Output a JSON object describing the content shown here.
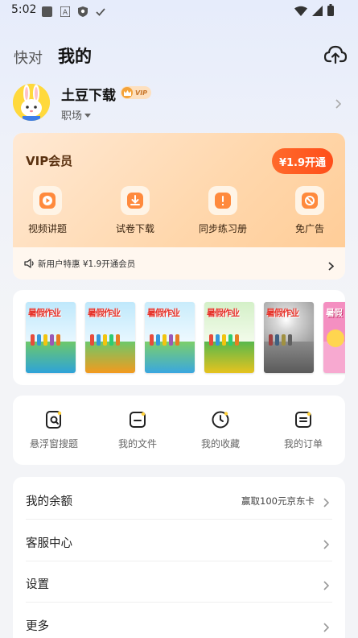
{
  "status_bar": {
    "time": "5:02",
    "left_icons": [
      "app-icon",
      "a-icon",
      "shield-icon",
      "check-icon"
    ],
    "right_icons": [
      "wifi-icon",
      "signal-icon",
      "battery-icon"
    ]
  },
  "header": {
    "tabs": [
      {
        "label": "快对",
        "active": false
      },
      {
        "label": "我的",
        "active": true
      }
    ],
    "upload_icon": "cloud-upload-icon"
  },
  "profile": {
    "username": "土豆下载",
    "vip_label": "VIP",
    "role": "职场"
  },
  "vip_card": {
    "title": "VIP会员",
    "open_button": "¥1.9开通",
    "features": [
      {
        "label": "视频讲题",
        "icon": "video-play-icon"
      },
      {
        "label": "试卷下载",
        "icon": "download-icon"
      },
      {
        "label": "同步练习册",
        "icon": "exercise-book-icon"
      },
      {
        "label": "免广告",
        "icon": "no-ads-icon"
      }
    ],
    "promo_text": "新用户特惠 ¥1.9开通会员",
    "accent": "#ff5a1f"
  },
  "books": [
    {
      "title": "暑假作业"
    },
    {
      "title": "暑假作业"
    },
    {
      "title": "暑假作业"
    },
    {
      "title": "暑假作业"
    },
    {
      "title": "暑假作业"
    },
    {
      "title": "暑假"
    }
  ],
  "tools": [
    {
      "label": "悬浮窗搜题",
      "icon": "search-doc-icon"
    },
    {
      "label": "我的文件",
      "icon": "folder-icon"
    },
    {
      "label": "我的收藏",
      "icon": "clock-icon"
    },
    {
      "label": "我的订单",
      "icon": "order-icon"
    }
  ],
  "menu": [
    {
      "label": "我的余额",
      "extra": "赢取100元京东卡"
    },
    {
      "label": "客服中心",
      "extra": ""
    },
    {
      "label": "设置",
      "extra": ""
    },
    {
      "label": "更多",
      "extra": ""
    }
  ]
}
